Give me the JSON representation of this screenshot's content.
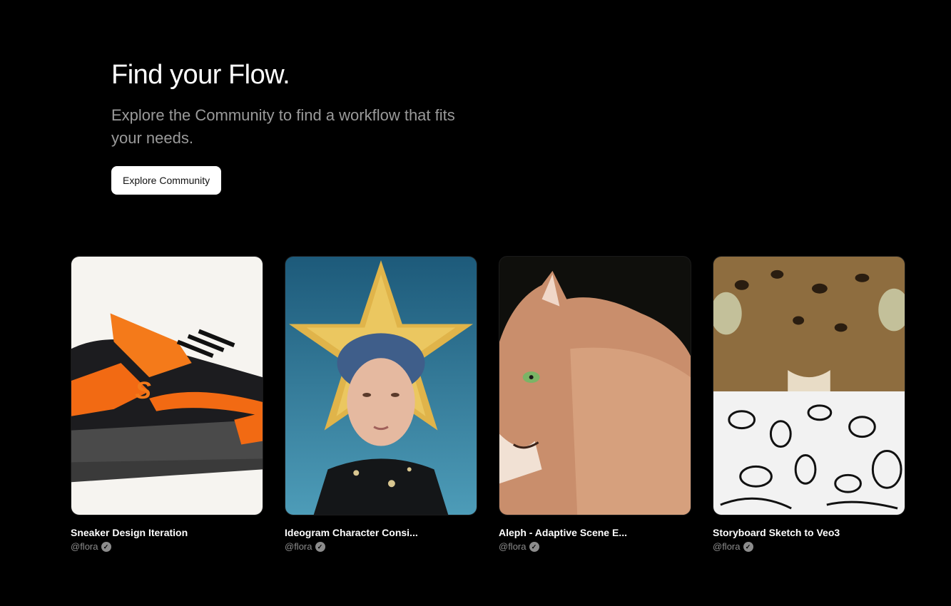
{
  "hero": {
    "title": "Find your Flow.",
    "subtitle": "Explore the Community to find a workflow that fits your needs.",
    "cta_label": "Explore Community"
  },
  "cards": [
    {
      "title": "Sneaker Design Iteration",
      "author": "@flora",
      "image": "orange-sneaker"
    },
    {
      "title": "Ideogram Character Consi...",
      "author": "@flora",
      "image": "woman-golden-star-portrait"
    },
    {
      "title": "Aleph - Adaptive Scene E...",
      "author": "@flora",
      "image": "cougar"
    },
    {
      "title": "Storyboard Sketch to Veo3",
      "author": "@flora",
      "image": "leopard-eyes-and-sketch"
    }
  ],
  "icons": {
    "verified": "verified-check-icon"
  },
  "colors": {
    "background": "#000000",
    "subtitle": "#9a9a9a",
    "button_bg": "#ffffff",
    "author": "#8c8c8c"
  }
}
